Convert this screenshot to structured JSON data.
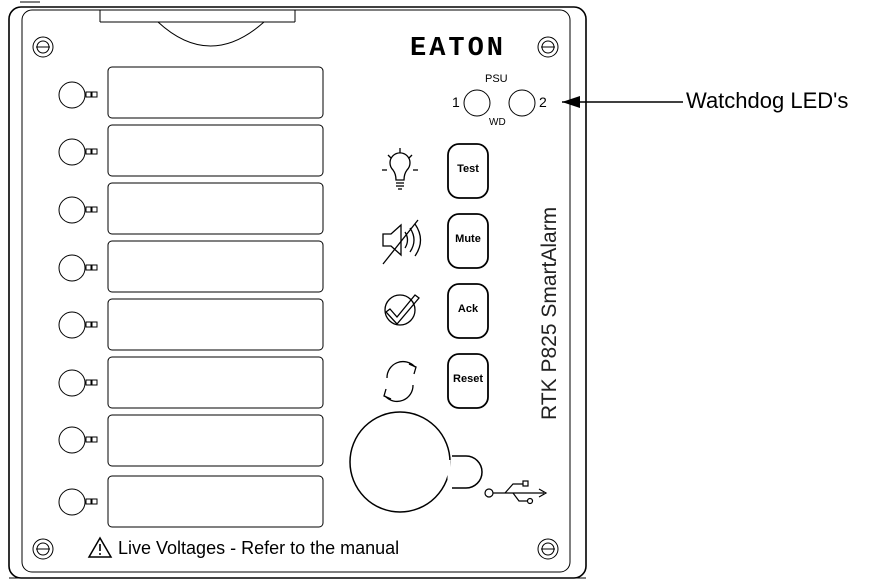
{
  "brand": "EATON",
  "product_name": "RTK P825 SmartAlarm",
  "watchdog": {
    "label_1": "1",
    "label_2": "2",
    "label_psu": "PSU",
    "label_wd": "WD",
    "callout": "Watchdog LED's"
  },
  "buttons": {
    "test": "Test",
    "mute": "Mute",
    "ack": "Ack",
    "reset": "Reset"
  },
  "warning": "Live Voltages - Refer to the manual",
  "alarm_channel_count": 8,
  "icons": [
    "lightbulb-icon",
    "speaker-muted-icon",
    "check-icon",
    "refresh-icon",
    "usb-icon",
    "warning-icon"
  ]
}
